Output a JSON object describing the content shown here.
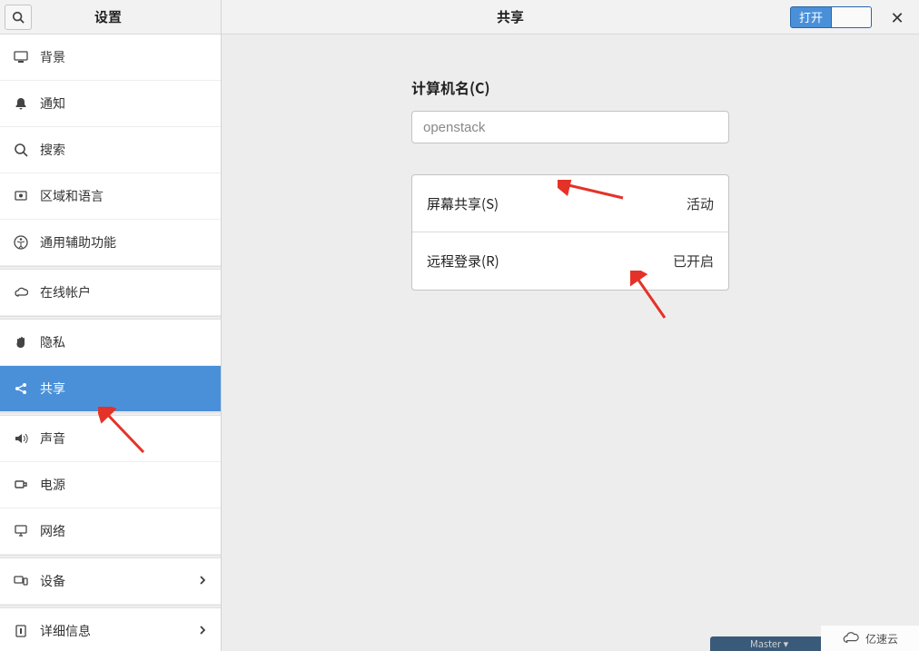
{
  "sidebar": {
    "title": "设置",
    "items": [
      {
        "icon": "display",
        "label": "背景",
        "chevron": false
      },
      {
        "icon": "bell",
        "label": "通知",
        "chevron": false
      },
      {
        "icon": "search",
        "label": "搜索",
        "chevron": false
      },
      {
        "icon": "globe",
        "label": "区域和语言",
        "chevron": false
      },
      {
        "icon": "accessibility",
        "label": "通用辅助功能",
        "chevron": false
      },
      {
        "icon": "cloud",
        "label": "在线帐户",
        "chevron": false,
        "sep_before": true
      },
      {
        "icon": "hand",
        "label": "隐私",
        "chevron": false,
        "sep_before": true
      },
      {
        "icon": "share",
        "label": "共享",
        "chevron": false,
        "active": true
      },
      {
        "icon": "volume",
        "label": "声音",
        "chevron": false,
        "sep_before": true
      },
      {
        "icon": "power",
        "label": "电源",
        "chevron": false
      },
      {
        "icon": "net",
        "label": "网络",
        "chevron": false
      },
      {
        "icon": "devices",
        "label": "设备",
        "chevron": true,
        "sep_before": true
      },
      {
        "icon": "info",
        "label": "详细信息",
        "chevron": true,
        "sep_before": true
      }
    ]
  },
  "main": {
    "title": "共享",
    "toggle_label": "打开",
    "computer_name_label": "计算机名(C)",
    "computer_name_value": "openstack",
    "rows": [
      {
        "label": "屏幕共享(S)",
        "status": "活动"
      },
      {
        "label": "远程登录(R)",
        "status": "已开启"
      }
    ]
  },
  "watermark": "亿速云",
  "bottom_fragment": "Master ▾"
}
